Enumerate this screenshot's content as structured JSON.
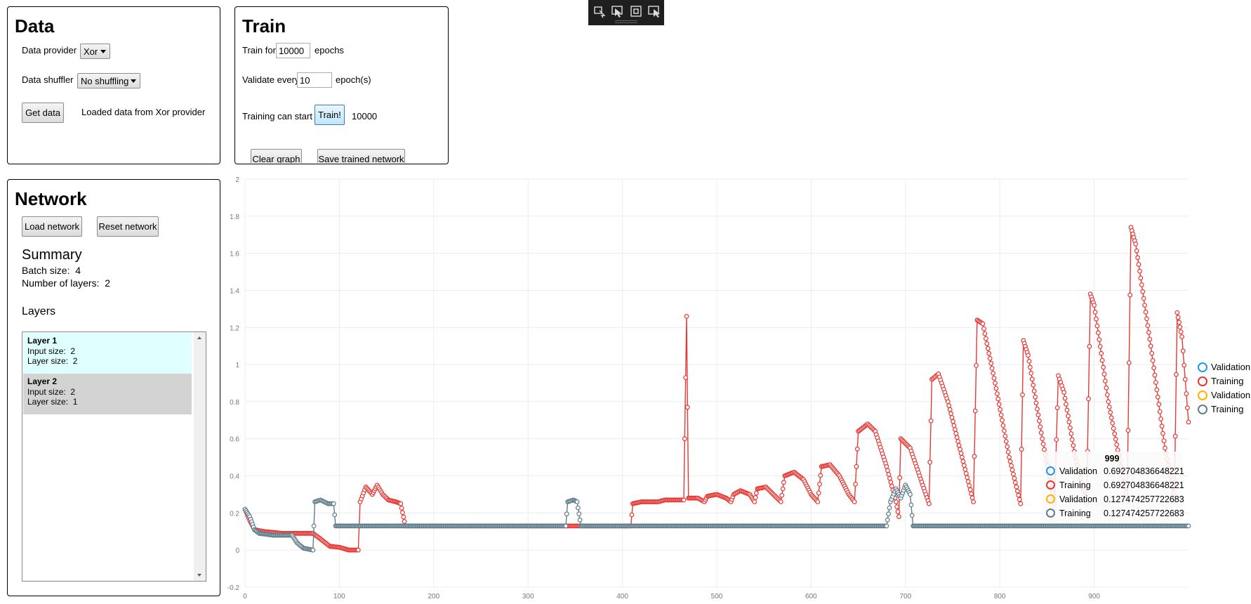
{
  "data_panel": {
    "title": "Data",
    "provider_label": "Data provider",
    "provider_value": "Xor",
    "shuffler_label": "Data shuffler",
    "shuffler_value": "No shuffling",
    "get_data_label": "Get data",
    "status": "Loaded data from Xor provider"
  },
  "train_panel": {
    "title": "Train",
    "train_for_label": "Train for",
    "epochs_value": "10000",
    "epochs_label": "epochs",
    "validate_label": "Validate every",
    "validate_value": "10",
    "validate_unit": "epoch(s)",
    "status_label": "Training can start",
    "train_button": "Train!",
    "train_count": "10000",
    "clear_button": "Clear graph",
    "save_button": "Save trained network"
  },
  "network_panel": {
    "title": "Network",
    "load_button": "Load network",
    "reset_button": "Reset network",
    "summary_title": "Summary",
    "batch_size_label": "Batch size:",
    "batch_size": "4",
    "num_layers_label": "Number of layers:",
    "num_layers": "2",
    "layers_title": "Layers",
    "layers": [
      {
        "name": "Layer  1",
        "input_label": "Input size:",
        "input_size": "2",
        "size_label": "Layer size:",
        "layer_size": "2"
      },
      {
        "name": "Layer  2",
        "input_label": "Input size:",
        "input_size": "2",
        "size_label": "Layer size:",
        "layer_size": "1"
      }
    ]
  },
  "toolbar": {
    "icons": [
      "select-element-icon",
      "pointer-icon",
      "frame-icon",
      "track-focus-icon"
    ]
  },
  "chart_data": {
    "type": "scatter",
    "xlim": [
      0,
      1000
    ],
    "ylim": [
      -0.2,
      2
    ],
    "x_ticks": [
      "0",
      "100",
      "200",
      "300",
      "400",
      "500",
      "600",
      "700",
      "800",
      "900"
    ],
    "y_ticks": [
      "2",
      "1.8",
      "1.6",
      "1.4",
      "1.2",
      "1",
      "0.8",
      "0.6",
      "0.4",
      "0.2",
      "0",
      "-0.2"
    ],
    "grid": true,
    "legend_placement": "right",
    "legend": [
      {
        "name": "Validation",
        "color": "#2196f3"
      },
      {
        "name": "Training",
        "color": "#e53935"
      },
      {
        "name": "Validation",
        "color": "#ffb300"
      },
      {
        "name": "Training",
        "color": "#607d8b"
      }
    ],
    "series": [
      {
        "name": "Training",
        "color": "#e53935",
        "points": [
          [
            0,
            0.22
          ],
          [
            5,
            0.16
          ],
          [
            10,
            0.11
          ],
          [
            20,
            0.1
          ],
          [
            40,
            0.09
          ],
          [
            60,
            0.09
          ],
          [
            72,
            0.09
          ],
          [
            80,
            0.06
          ],
          [
            90,
            0.02
          ],
          [
            100,
            0.015
          ],
          [
            110,
            0.0
          ],
          [
            120,
            0.0
          ],
          [
            122,
            0.26
          ],
          [
            128,
            0.34
          ],
          [
            135,
            0.3
          ],
          [
            140,
            0.35
          ],
          [
            146,
            0.3
          ],
          [
            152,
            0.27
          ],
          [
            160,
            0.26
          ],
          [
            165,
            0.25
          ],
          [
            170,
            0.13
          ],
          [
            200,
            0.13
          ],
          [
            300,
            0.13
          ],
          [
            340,
            0.13
          ],
          [
            360,
            0.13
          ],
          [
            409,
            0.13
          ],
          [
            411,
            0.25
          ],
          [
            420,
            0.26
          ],
          [
            430,
            0.26
          ],
          [
            438,
            0.26
          ],
          [
            445,
            0.27
          ],
          [
            455,
            0.27
          ],
          [
            465,
            0.27
          ],
          [
            468,
            1.26
          ],
          [
            470,
            0.28
          ],
          [
            480,
            0.28
          ],
          [
            487,
            0.26
          ],
          [
            490,
            0.29
          ],
          [
            500,
            0.3
          ],
          [
            510,
            0.28
          ],
          [
            515,
            0.26
          ],
          [
            518,
            0.3
          ],
          [
            525,
            0.32
          ],
          [
            535,
            0.3
          ],
          [
            540,
            0.26
          ],
          [
            543,
            0.33
          ],
          [
            552,
            0.34
          ],
          [
            560,
            0.3
          ],
          [
            568,
            0.26
          ],
          [
            572,
            0.4
          ],
          [
            582,
            0.42
          ],
          [
            592,
            0.38
          ],
          [
            600,
            0.3
          ],
          [
            607,
            0.26
          ],
          [
            611,
            0.45
          ],
          [
            620,
            0.46
          ],
          [
            630,
            0.4
          ],
          [
            640,
            0.3
          ],
          [
            646,
            0.26
          ],
          [
            650,
            0.64
          ],
          [
            660,
            0.68
          ],
          [
            668,
            0.64
          ],
          [
            680,
            0.45
          ],
          [
            690,
            0.26
          ],
          [
            693,
            0.18
          ],
          [
            695,
            0.6
          ],
          [
            705,
            0.55
          ],
          [
            715,
            0.4
          ],
          [
            725,
            0.25
          ],
          [
            728,
            0.92
          ],
          [
            735,
            0.95
          ],
          [
            745,
            0.8
          ],
          [
            760,
            0.5
          ],
          [
            772,
            0.26
          ],
          [
            776,
            1.24
          ],
          [
            782,
            1.22
          ],
          [
            795,
            0.9
          ],
          [
            810,
            0.5
          ],
          [
            822,
            0.25
          ],
          [
            825,
            1.13
          ],
          [
            830,
            1.05
          ],
          [
            845,
            0.6
          ],
          [
            858,
            0.25
          ],
          [
            862,
            0.94
          ],
          [
            868,
            0.85
          ],
          [
            880,
            0.5
          ],
          [
            892,
            0.25
          ],
          [
            896,
            1.38
          ],
          [
            900,
            1.32
          ],
          [
            915,
            0.8
          ],
          [
            935,
            0.28
          ],
          [
            939,
            1.74
          ],
          [
            944,
            1.65
          ],
          [
            960,
            1.1
          ],
          [
            975,
            0.55
          ],
          [
            985,
            0.28
          ],
          [
            988,
            1.28
          ],
          [
            993,
            1.15
          ],
          [
            1000,
            0.69
          ]
        ]
      },
      {
        "name": "Training",
        "color": "#607d8b",
        "points": [
          [
            0,
            0.22
          ],
          [
            5,
            0.18
          ],
          [
            10,
            0.11
          ],
          [
            15,
            0.09
          ],
          [
            30,
            0.08
          ],
          [
            50,
            0.08
          ],
          [
            55,
            0.04
          ],
          [
            62,
            0.01
          ],
          [
            72,
            0.0
          ],
          [
            74,
            0.26
          ],
          [
            80,
            0.27
          ],
          [
            88,
            0.25
          ],
          [
            94,
            0.25
          ],
          [
            96,
            0.13
          ],
          [
            200,
            0.13
          ],
          [
            340,
            0.13
          ],
          [
            342,
            0.26
          ],
          [
            348,
            0.27
          ],
          [
            352,
            0.26
          ],
          [
            356,
            0.13
          ],
          [
            500,
            0.13
          ],
          [
            680,
            0.13
          ],
          [
            684,
            0.26
          ],
          [
            690,
            0.33
          ],
          [
            695,
            0.28
          ],
          [
            700,
            0.35
          ],
          [
            705,
            0.3
          ],
          [
            708,
            0.13
          ],
          [
            800,
            0.13
          ],
          [
            900,
            0.13
          ],
          [
            1000,
            0.13
          ]
        ]
      }
    ],
    "tooltip": {
      "x": "999",
      "rows": [
        {
          "name": "Validation",
          "value": "0.692704836648221",
          "color": "#2196f3"
        },
        {
          "name": "Training",
          "value": "0.692704836648221",
          "color": "#e53935"
        },
        {
          "name": "Validation",
          "value": "0.127474257722683",
          "color": "#ffb300"
        },
        {
          "name": "Training",
          "value": "0.127474257722683",
          "color": "#607d8b"
        }
      ]
    }
  }
}
